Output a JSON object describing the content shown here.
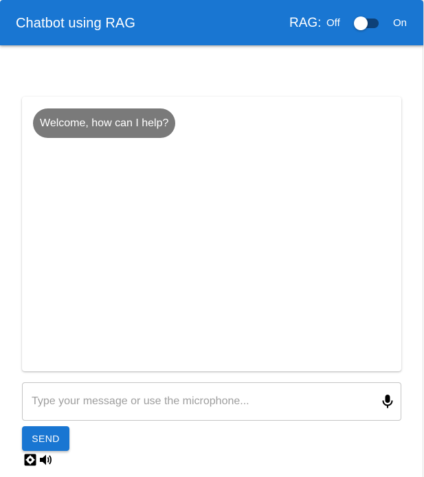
{
  "header": {
    "title": "Chatbot using RAG",
    "rag_label": "RAG:",
    "rag_off_label": "Off",
    "rag_on_label": "On",
    "rag_enabled": false
  },
  "chat": {
    "messages": [
      {
        "role": "bot",
        "text": "Welcome, how can I help?"
      }
    ]
  },
  "composer": {
    "placeholder": "Type your message or use the microphone...",
    "value": "",
    "send_label": "Send"
  },
  "icons": {
    "mic": "microphone-icon",
    "settings": "gear-icon",
    "audio": "speaker-icon"
  },
  "colors": {
    "primary": "#1976d2",
    "bot_bubble": "#7a7a7a",
    "switch_track": "#0d3c6e"
  }
}
